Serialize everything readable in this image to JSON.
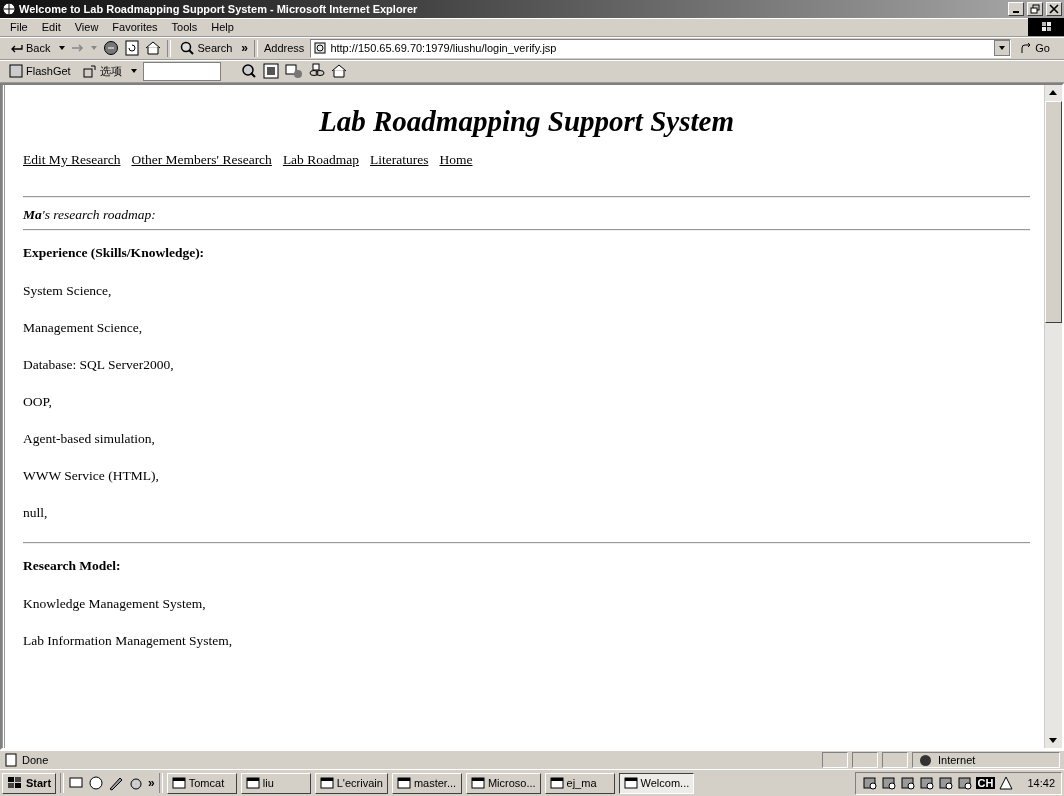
{
  "window": {
    "title": "Welcome to Lab Roadmapping Support System - Microsoft Internet Explorer"
  },
  "menu": [
    "File",
    "Edit",
    "View",
    "Favorites",
    "Tools",
    "Help"
  ],
  "toolbar": {
    "back": "Back",
    "search": "Search",
    "more": "»",
    "address_label": "Address",
    "address": "http://150.65.69.70:1979/liushu/login_verify.jsp",
    "go": "Go"
  },
  "flashget_bar": {
    "flashget": "FlashGet",
    "options": "选项"
  },
  "page": {
    "title": "Lab Roadmapping Support System",
    "nav": [
      "Edit My Research",
      "Other Members' Research",
      "Lab Roadmap",
      "Literatures",
      "Home"
    ],
    "owner": "**Ma**'s research roadmap:",
    "sections": [
      {
        "heading": "Experience (Skills/Knowledge):",
        "items": [
          "System Science,",
          "Management Science,",
          "Database: SQL Server2000,",
          "OOP,",
          "Agent-based simulation,",
          "WWW Service (HTML),",
          "null,"
        ]
      },
      {
        "heading": "Research Model:",
        "items": [
          "Knowledge Management System,",
          "Lab Information Management System,"
        ]
      }
    ]
  },
  "status_bar": {
    "text": "Done",
    "zone": "Internet"
  },
  "taskbar": {
    "start": "Start",
    "more": "»",
    "tasks": [
      {
        "label": "Tomcat",
        "selected": false
      },
      {
        "label": "liu",
        "selected": false
      },
      {
        "label": "L'ecrivain",
        "selected": false
      },
      {
        "label": "master...",
        "selected": false
      },
      {
        "label": "Microso...",
        "selected": false
      },
      {
        "label": "ej_ma",
        "selected": false
      },
      {
        "label": "Welcom...",
        "selected": true
      }
    ],
    "language": "CH",
    "clock": "14:42"
  }
}
